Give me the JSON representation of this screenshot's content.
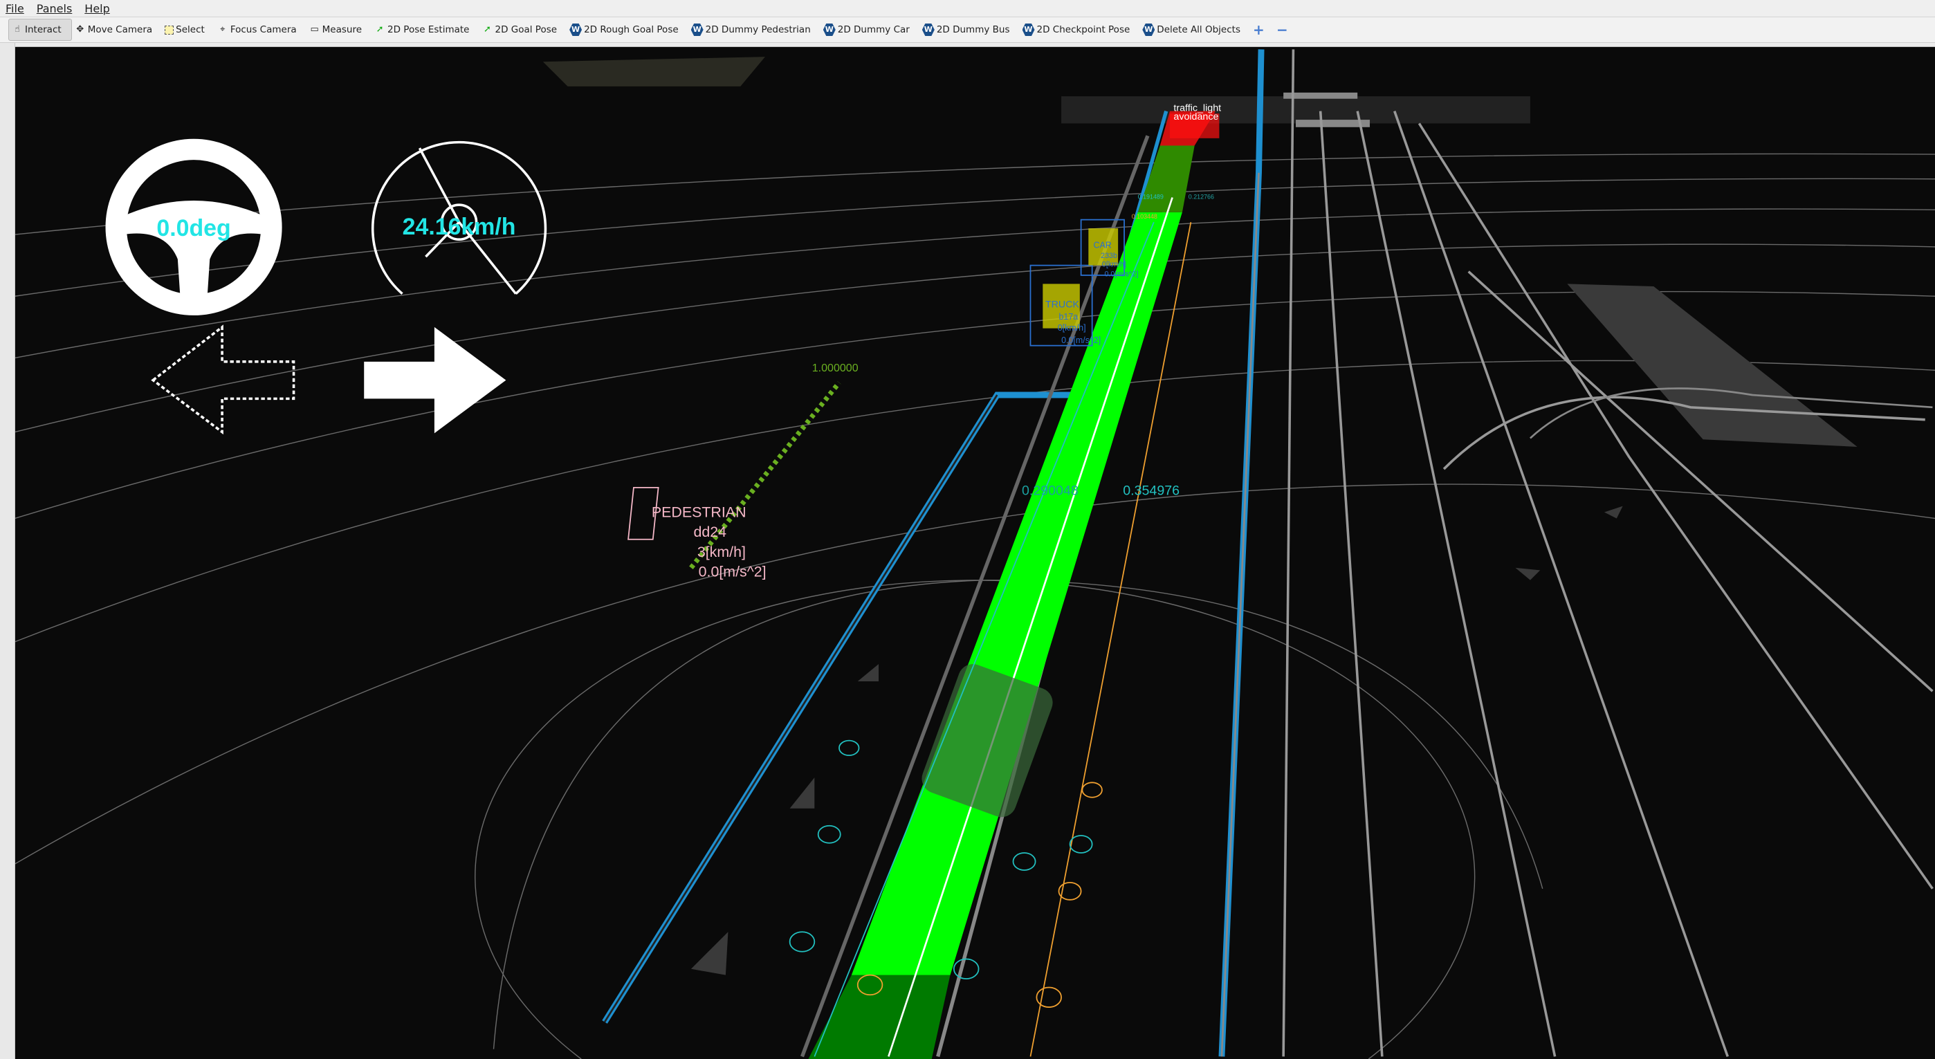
{
  "menu": [
    "File",
    "Panels",
    "Help"
  ],
  "toolbar": [
    {
      "label": "Interact",
      "icon": "hand-icon"
    },
    {
      "label": "Move Camera",
      "icon": "move-icon"
    },
    {
      "label": "Select",
      "icon": "select-icon"
    },
    {
      "label": "Focus Camera",
      "icon": "focus-icon"
    },
    {
      "label": "Measure",
      "icon": "ruler-icon"
    },
    {
      "label": "2D Pose Estimate",
      "icon": "green-arrow-icon"
    },
    {
      "label": "2D Goal Pose",
      "icon": "green-arrow-icon"
    },
    {
      "label": "2D Rough Goal Pose",
      "icon": "autoware-icon"
    },
    {
      "label": "2D Dummy Pedestrian",
      "icon": "autoware-icon"
    },
    {
      "label": "2D Dummy Car",
      "icon": "autoware-icon"
    },
    {
      "label": "2D Dummy Bus",
      "icon": "autoware-icon"
    },
    {
      "label": "2D Checkpoint Pose",
      "icon": "autoware-icon"
    },
    {
      "label": "Delete All Objects",
      "icon": "autoware-icon"
    }
  ],
  "hud": {
    "steering": "0.0deg",
    "speed": "24.16km/h"
  },
  "scene": {
    "traffic_label": [
      "traffic_light",
      "avoidance"
    ],
    "ped": {
      "type": "PEDESTRIAN",
      "id": "dd24",
      "vel": "3[km/h]",
      "acc": "0.0[m/s^2]"
    },
    "car": {
      "type": "CAR",
      "id": "233b",
      "vel": "0[km/h]",
      "acc": "0.0[m/s^2]"
    },
    "truck": {
      "type": "TRUCK",
      "id": "b17a",
      "vel": "0[km/h]",
      "acc": "0.0[m/s^2]"
    },
    "values": {
      "v1": "1.000000",
      "v2": "0.290048",
      "v3": "0.354976",
      "v4": "0.191489",
      "v5": "0.103448",
      "v6": "0.212766"
    }
  },
  "colors": {
    "path": "#00ff00",
    "lane": "#1e90d0",
    "hud": "#22e5e5",
    "ped": "#f5b8c8"
  }
}
